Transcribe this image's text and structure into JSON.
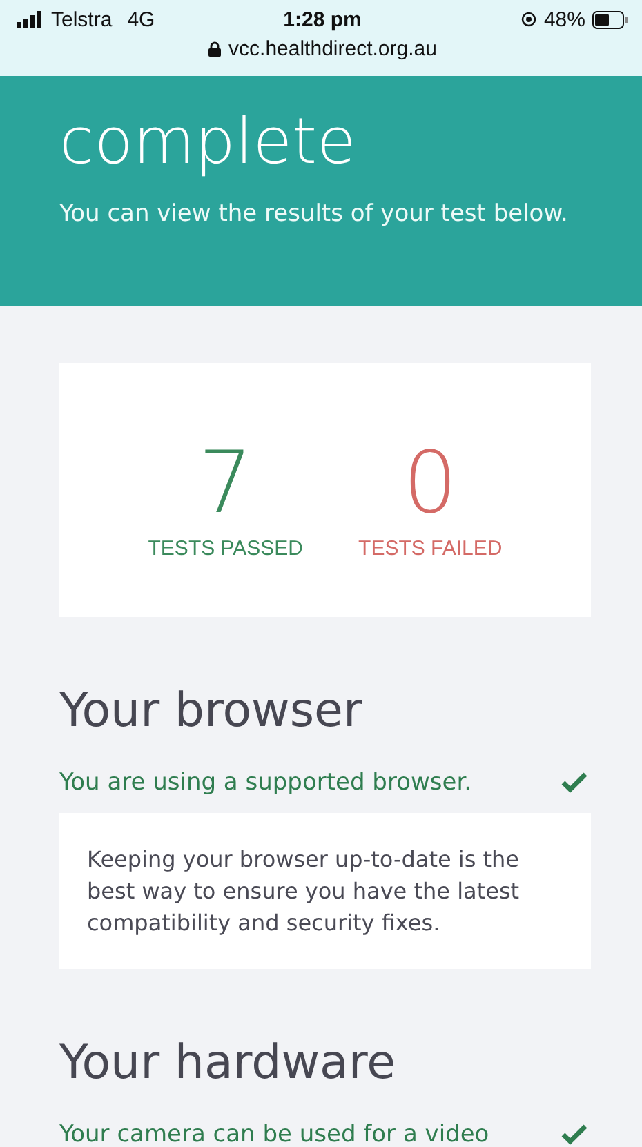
{
  "status_bar": {
    "carrier": "Telstra",
    "network": "4G",
    "time": "1:28 pm",
    "battery": "48%",
    "url": "vcc.healthdirect.org.au"
  },
  "header": {
    "title": "complete",
    "subtitle": "You can view the results of your test below."
  },
  "summary": [
    {
      "kind": "pass",
      "count": "7",
      "label": "TESTS PASSED"
    },
    {
      "kind": "fail",
      "count": "0",
      "label": "TESTS FAILED"
    }
  ],
  "sections": [
    {
      "title": "Your browser",
      "result": "You are using a supported browser.",
      "passed": true,
      "note": "Keeping your browser up-to-date is the best way to ensure you have the latest compatibility and security fixes."
    },
    {
      "title": "Your hardware",
      "result": "Your camera can be used for a video",
      "passed": true
    }
  ]
}
